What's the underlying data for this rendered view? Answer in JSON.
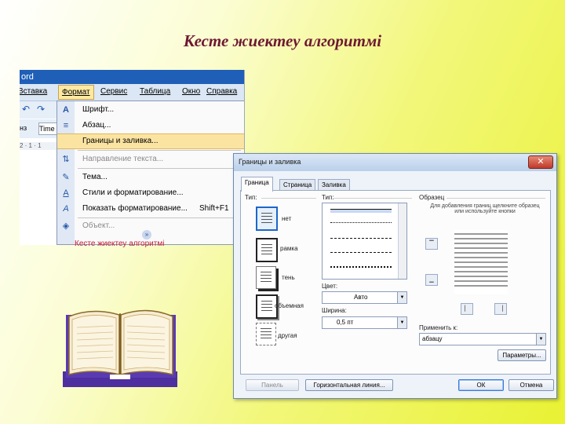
{
  "slide": {
    "title": "Кесте жиектеу алгоритмі"
  },
  "word": {
    "app_title": "ord",
    "menubar": [
      "Вставка",
      "Формат",
      "Сервис",
      "Таблица",
      "Окно",
      "Справка"
    ],
    "active_menu": "Формат",
    "font_name": "Time",
    "ruler": "2 · 1 · 1",
    "menu_items": [
      {
        "icon": "font-icon",
        "glyph": "A",
        "label": "Шрифт...",
        "shortcut": "",
        "state": "normal"
      },
      {
        "icon": "paragraph-icon",
        "glyph": "≡",
        "label": "Абзац...",
        "shortcut": "",
        "state": "normal"
      },
      {
        "icon": "",
        "glyph": "",
        "label": "Границы и заливка...",
        "shortcut": "",
        "state": "highlighted"
      },
      {
        "icon": "text-direction-icon",
        "glyph": "⇅",
        "label": "Направление текста...",
        "shortcut": "",
        "state": "disabled"
      },
      {
        "icon": "theme-icon",
        "glyph": "✎",
        "label": "Тема...",
        "shortcut": "",
        "state": "normal"
      },
      {
        "icon": "styles-icon",
        "glyph": "A",
        "label": "Стили и форматирование...",
        "shortcut": "",
        "state": "normal"
      },
      {
        "icon": "reveal-formatting-icon",
        "glyph": "A",
        "label": "Показать форматирование...",
        "shortcut": "Shift+F1",
        "state": "normal"
      },
      {
        "icon": "object-icon",
        "glyph": "◈",
        "label": "Объект...",
        "shortcut": "",
        "state": "disabled"
      }
    ],
    "below_text": "Кесте жиектеу алгоритмі"
  },
  "dialog": {
    "title": "Границы и заливка",
    "close_glyph": "✕",
    "tabs": [
      "Граница",
      "Страница",
      "Заливка"
    ],
    "active_tab": "Граница",
    "type_label": "Тип:",
    "types": [
      "нет",
      "рамка",
      "тень",
      "объемная",
      "другая"
    ],
    "selected_type": "нет",
    "style_label": "Тип:",
    "color_label": "Цвет:",
    "color_value": "Авто",
    "width_label": "Ширина:",
    "width_value": "0,5 пт",
    "preview_label": "Образец",
    "preview_hint": "Для добавления границ щелкните образец или используйте кнопки",
    "apply_label": "Применить к:",
    "apply_value": "абзацу",
    "params_button": "Параметры...",
    "panel_button": "Панель",
    "hline_button": "Горизонтальная линия...",
    "ok_button": "ОК",
    "cancel_button": "Отмена"
  }
}
